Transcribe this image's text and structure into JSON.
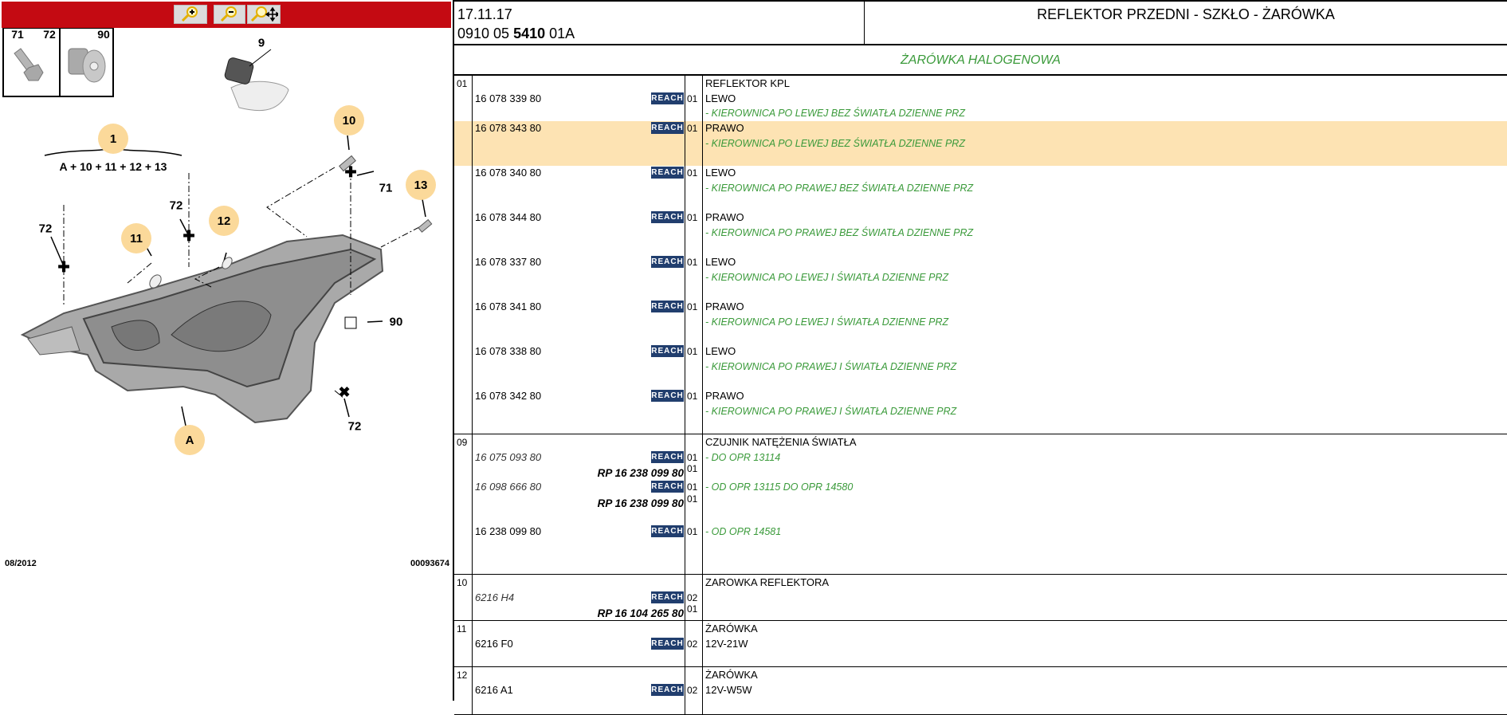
{
  "toolbar": {
    "zoom_in": "zoom-in",
    "zoom_out": "zoom-out",
    "zoom_pan": "zoom-pan"
  },
  "diagram": {
    "inset_labels": [
      "71",
      "72",
      "90"
    ],
    "callouts": {
      "c9": "9",
      "c1": "1",
      "c10": "10",
      "c11": "11",
      "c12": "12",
      "c13": "13",
      "cA": "A"
    },
    "plain_labels": {
      "l72a": "72",
      "l72b": "72",
      "l72c": "72",
      "l71": "71",
      "l90": "90"
    },
    "formula": "A + 10 + 11 + 12 + 13",
    "date": "08/2012",
    "ref": "00093674"
  },
  "header": {
    "date": "17.11.17",
    "code_prefix": "0910 05 ",
    "code_bold": "5410",
    "code_suffix": " 01A",
    "title": "REFLEKTOR PRZEDNI - SZKŁO - ŻARÓWKA",
    "subtitle": "ŻARÓWKA HALOGENOWA"
  },
  "colors": {
    "accent_red": "#c40a12",
    "highlight": "#fde3b3",
    "green": "#3a9a3a",
    "reach": "#213e6e"
  },
  "groups": [
    {
      "num": "01",
      "lines": [
        {
          "desc": "REFLEKTOR KPL"
        },
        {
          "part": "16 078 339 80",
          "reach": "REACH",
          "qty": "01",
          "desc": "LEWO"
        },
        {
          "note": "- KIEROWNICA PO LEWEJ BEZ ŚWIATŁA DZIENNE PRZ"
        },
        {
          "part": "16 078 343 80",
          "reach": "REACH",
          "qty": "01",
          "desc": "PRAWO",
          "hl": true
        },
        {
          "note": "- KIEROWNICA PO LEWEJ BEZ ŚWIATŁA DZIENNE PRZ",
          "hl": true
        },
        {
          "hl": true
        },
        {
          "part": "16 078 340 80",
          "reach": "REACH",
          "qty": "01",
          "desc": "LEWO"
        },
        {
          "note": "- KIEROWNICA PO PRAWEJ BEZ ŚWIATŁA DZIENNE PRZ"
        },
        {},
        {
          "part": "16 078 344 80",
          "reach": "REACH",
          "qty": "01",
          "desc": "PRAWO"
        },
        {
          "note": "- KIEROWNICA PO PRAWEJ BEZ ŚWIATŁA DZIENNE PRZ"
        },
        {},
        {
          "part": "16 078 337 80",
          "reach": "REACH",
          "qty": "01",
          "desc": "LEWO"
        },
        {
          "note": "- KIEROWNICA PO LEWEJ I ŚWIATŁA DZIENNE PRZ"
        },
        {},
        {
          "part": "16 078 341 80",
          "reach": "REACH",
          "qty": "01",
          "desc": "PRAWO"
        },
        {
          "note": "- KIEROWNICA PO LEWEJ I ŚWIATŁA DZIENNE PRZ"
        },
        {},
        {
          "part": "16 078 338 80",
          "reach": "REACH",
          "qty": "01",
          "desc": "LEWO"
        },
        {
          "note": "- KIEROWNICA PO PRAWEJ I ŚWIATŁA DZIENNE PRZ"
        },
        {},
        {
          "part": "16 078 342 80",
          "reach": "REACH",
          "qty": "01",
          "desc": "PRAWO"
        },
        {
          "note": "- KIEROWNICA PO PRAWEJ I ŚWIATŁA DZIENNE PRZ"
        },
        {}
      ]
    },
    {
      "num": "09",
      "lines": [
        {
          "desc": "CZUJNIK NATĘŻENIA ŚWIATŁA"
        },
        {
          "part": "16 075 093 80",
          "italic": true,
          "reach": "REACH",
          "qty": "01",
          "note": "- DO OPR 13114"
        },
        {
          "rp": "RP 16 238 099 80",
          "qty": "01"
        },
        {
          "part": "16 098 666 80",
          "italic": true,
          "reach": "REACH",
          "qty": "01",
          "note": "- OD OPR 13115 DO OPR 14580"
        },
        {
          "rp": "RP 16 238 099 80",
          "qty": "01"
        },
        {},
        {
          "part": "16 238 099 80",
          "reach": "REACH",
          "qty": "01",
          "note": "- OD OPR 14581"
        },
        {},
        {}
      ]
    },
    {
      "num": "10",
      "lines": [
        {
          "desc": "ZAROWKA REFLEKTORA"
        },
        {
          "part": "6216 H4",
          "italic": true,
          "reach": "REACH",
          "qty": "02"
        },
        {
          "rp": "RP 16 104 265 80",
          "qty": "01"
        }
      ]
    },
    {
      "num": "11",
      "lines": [
        {
          "desc": "ŻARÓWKA"
        },
        {
          "part": "6216 F0",
          "reach": "REACH",
          "qty": "02",
          "desc": "12V-21W"
        },
        {}
      ]
    },
    {
      "num": "12",
      "lines": [
        {
          "desc": "ŻARÓWKA"
        },
        {
          "part": "6216 A1",
          "reach": "REACH",
          "qty": "02",
          "desc": "12V-W5W"
        }
      ]
    }
  ]
}
